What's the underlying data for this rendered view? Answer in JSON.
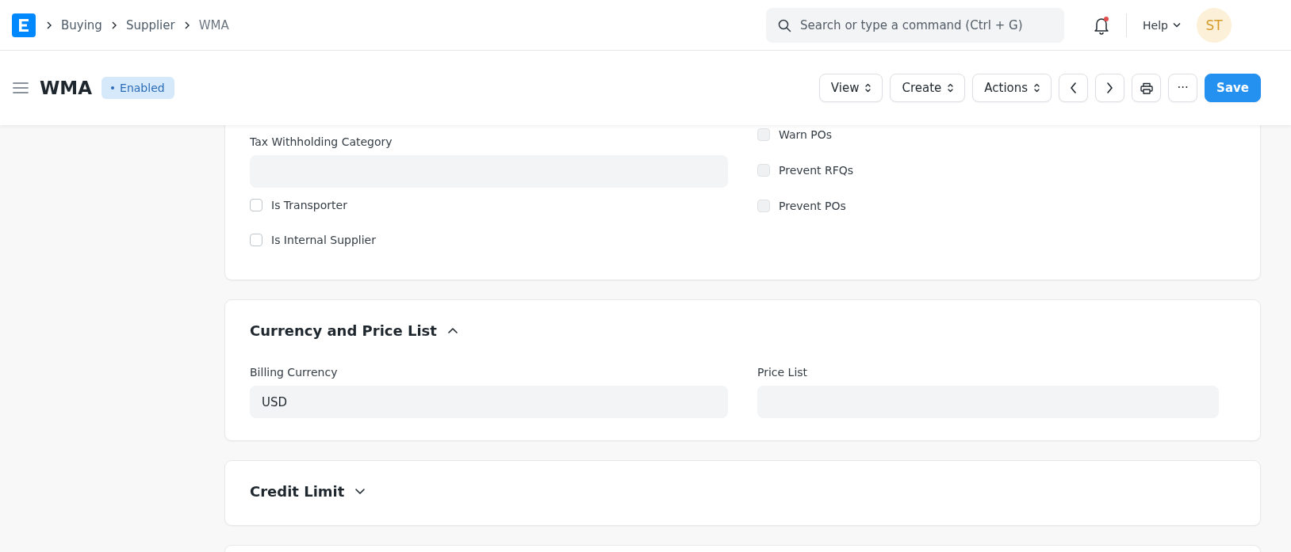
{
  "navbar": {
    "breadcrumbs": [
      "Buying",
      "Supplier",
      "WMA"
    ],
    "search": {
      "placeholder": "Search or type a command (Ctrl + G)"
    },
    "notifications_unread": true,
    "help": "Help",
    "avatar": "ST"
  },
  "header": {
    "title": "WMA",
    "status": "Enabled",
    "buttons": [
      {
        "kind": "dropdown",
        "label": "View"
      },
      {
        "kind": "dropdown",
        "label": "Create"
      },
      {
        "kind": "dropdown",
        "label": "Actions"
      },
      {
        "kind": "prev"
      },
      {
        "kind": "next"
      },
      {
        "kind": "print"
      },
      {
        "kind": "more",
        "label": "···"
      },
      {
        "kind": "primary",
        "label": "Save"
      }
    ]
  },
  "sections": [
    {
      "left": [
        {
          "kind": "field",
          "label": "Tax Withholding Category"
        },
        {
          "kind": "checkbox",
          "label": "Is Transporter",
          "checked": false,
          "disabled": false
        },
        {
          "kind": "checkbox",
          "label": "Is Internal Supplier",
          "checked": false,
          "disabled": false
        }
      ],
      "right": [
        {
          "kind": "checkbox",
          "label": "Warn POs",
          "checked": false,
          "disabled": true
        },
        {
          "kind": "checkbox",
          "label": "Prevent RFQs",
          "checked": false,
          "disabled": true
        },
        {
          "kind": "checkbox",
          "label": "Prevent POs",
          "checked": false,
          "disabled": true
        }
      ]
    },
    {
      "title": "Currency and Price List",
      "expanded": true,
      "left": [
        {
          "kind": "field",
          "label": "Billing Currency",
          "value": "USD"
        }
      ],
      "right": [
        {
          "kind": "field",
          "label": "Price List"
        }
      ]
    },
    {
      "title": "Credit Limit",
      "expanded": false
    }
  ]
}
